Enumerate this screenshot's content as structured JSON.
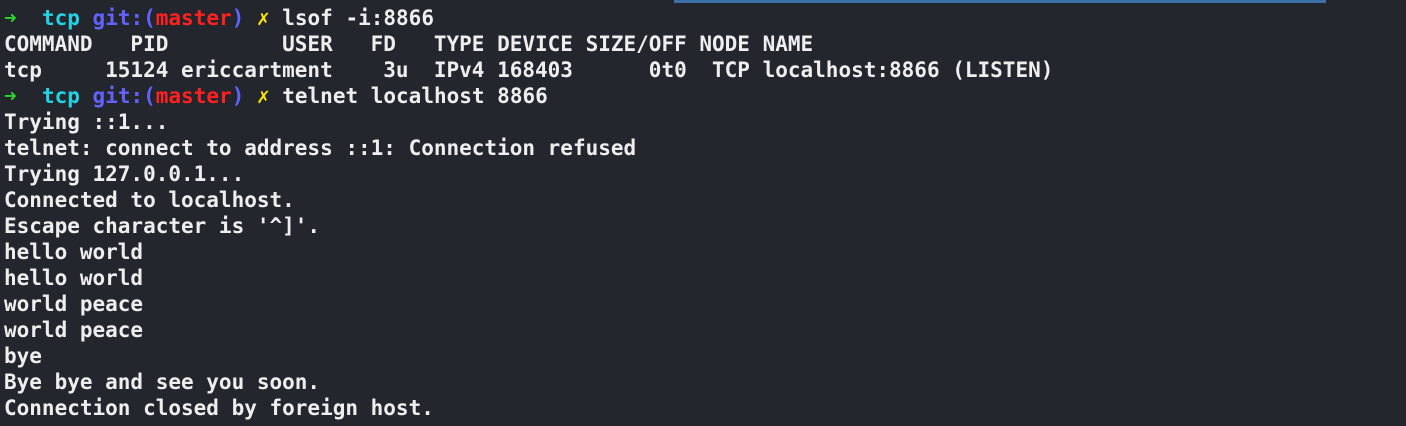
{
  "colors": {
    "background": "#23272d",
    "text": "#eeeeee",
    "prompt_arrow": "#2fd62f",
    "prompt_dir": "#22d3e6",
    "prompt_git": "#6262ff",
    "prompt_branch": "#ff2020",
    "prompt_dirty": "#ffe600",
    "top_accent": "#3b6fa8"
  },
  "prompt": {
    "arrow": "➜",
    "dir": "tcp",
    "git_open": "git:(",
    "branch": "master",
    "git_close": ")",
    "dirty_mark": "✗"
  },
  "commands": [
    "lsof -i:8866",
    "telnet localhost 8866"
  ],
  "lsof": {
    "header": "COMMAND   PID         USER   FD   TYPE DEVICE SIZE/OFF NODE NAME",
    "row": "tcp     15124 ericcartment    3u  IPv4 168403      0t0  TCP localhost:8866 (LISTEN)"
  },
  "output": [
    "Trying ::1...",
    "telnet: connect to address ::1: Connection refused",
    "Trying 127.0.0.1...",
    "Connected to localhost.",
    "Escape character is '^]'.",
    "hello world",
    "hello world",
    "world peace",
    "world peace",
    "bye",
    "Bye bye and see you soon.",
    "Connection closed by foreign host."
  ]
}
